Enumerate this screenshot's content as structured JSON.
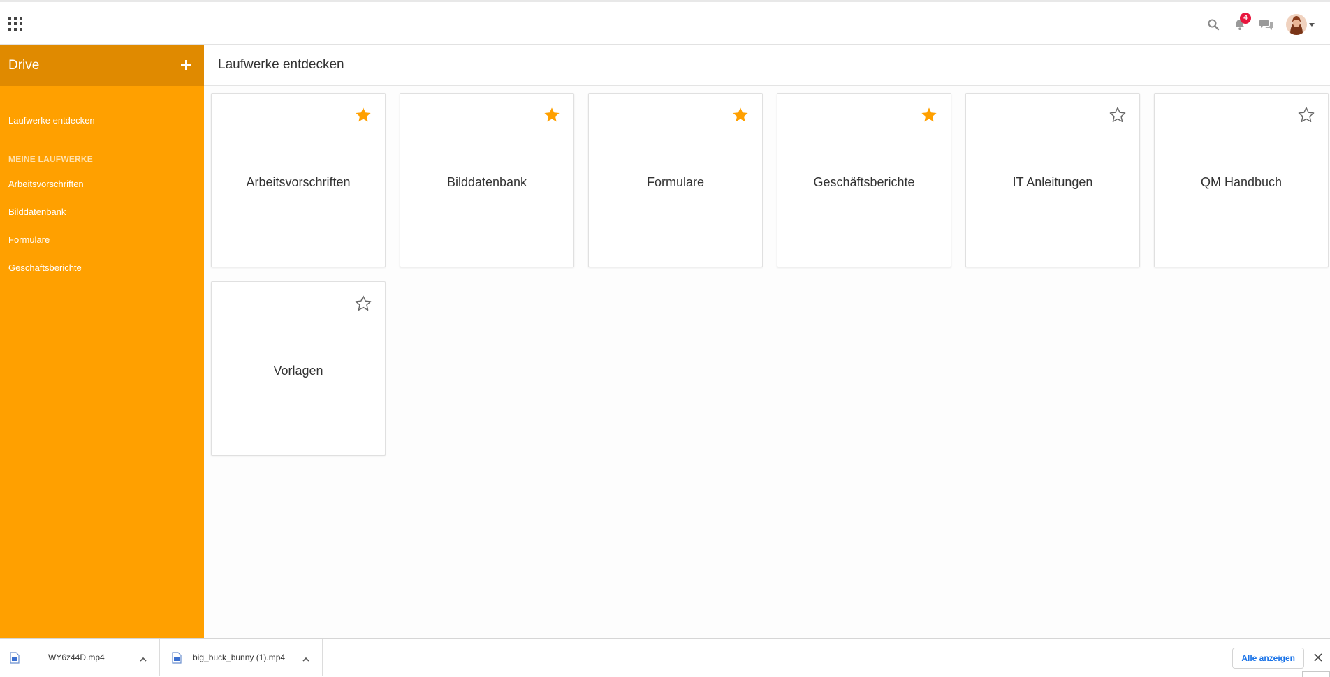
{
  "header": {
    "apps_icon": "apps-grid-icon",
    "icons": [
      "search-icon",
      "bell-icon",
      "chat-icon"
    ],
    "notification_count": "4",
    "accent": "#e8163e"
  },
  "sidebar": {
    "title": "Drive",
    "add_icon": "plus-icon",
    "background": "#ffa000",
    "header_background": "#e08a00",
    "discover_link": "Laufwerke entdecken",
    "section_title": "MEINE LAUFWERKE",
    "items": [
      {
        "label": "Arbeitsvorschriften"
      },
      {
        "label": "Bilddatenbank"
      },
      {
        "label": "Formulare"
      },
      {
        "label": "Geschäftsberichte"
      }
    ]
  },
  "main": {
    "title": "Laufwerke entdecken",
    "drives": [
      {
        "name": "Arbeitsvorschriften",
        "favorite": true
      },
      {
        "name": "Bilddatenbank",
        "favorite": true
      },
      {
        "name": "Formulare",
        "favorite": true
      },
      {
        "name": "Geschäftsberichte",
        "favorite": true
      },
      {
        "name": "IT Anleitungen",
        "favorite": false
      },
      {
        "name": "QM Handbuch",
        "favorite": false
      },
      {
        "name": "Vorlagen",
        "favorite": false
      }
    ],
    "star_color": "#ffa000"
  },
  "downloads": {
    "items": [
      {
        "name": "WY6z44D.mp4"
      },
      {
        "name": "big_buck_bunny (1).mp4"
      }
    ],
    "show_all": "Alle anzeigen"
  }
}
